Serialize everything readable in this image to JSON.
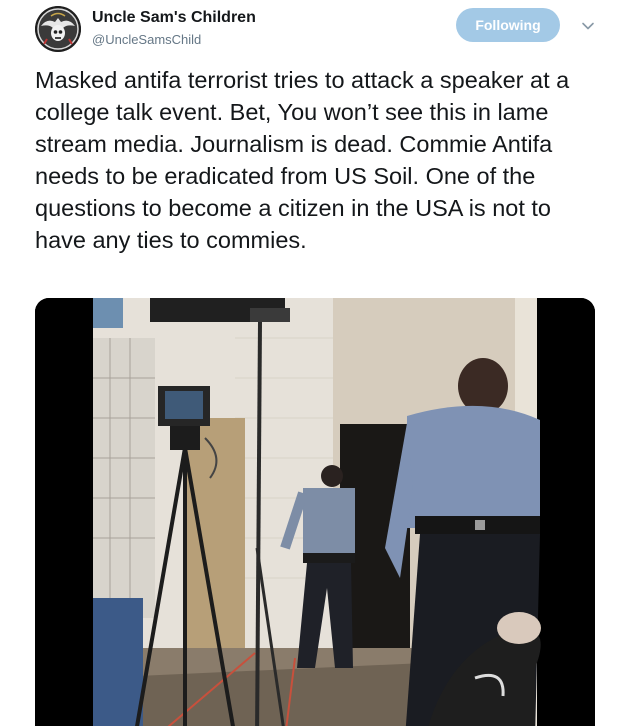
{
  "account": {
    "display_name": "Uncle Sam's Children",
    "handle": "@UncleSamsChild",
    "avatar_icon": "eagle-skull-emblem-icon"
  },
  "follow_button": {
    "label": "Following",
    "color": "#a3c9e6"
  },
  "menu": {
    "icon": "chevron-down-icon"
  },
  "tweet": {
    "text": "Masked antifa terrorist tries to attack a speaker at a college talk event. Bet, You won’t see this in lame stream media. Journalism is dead. Commie Antifa needs to be eradicated from US Soil. One of the questions to become a citizen in the USA is not to have any ties to commies."
  },
  "media": {
    "type": "video-still"
  },
  "colors": {
    "text_primary": "#14171a",
    "text_secondary": "#657786"
  }
}
